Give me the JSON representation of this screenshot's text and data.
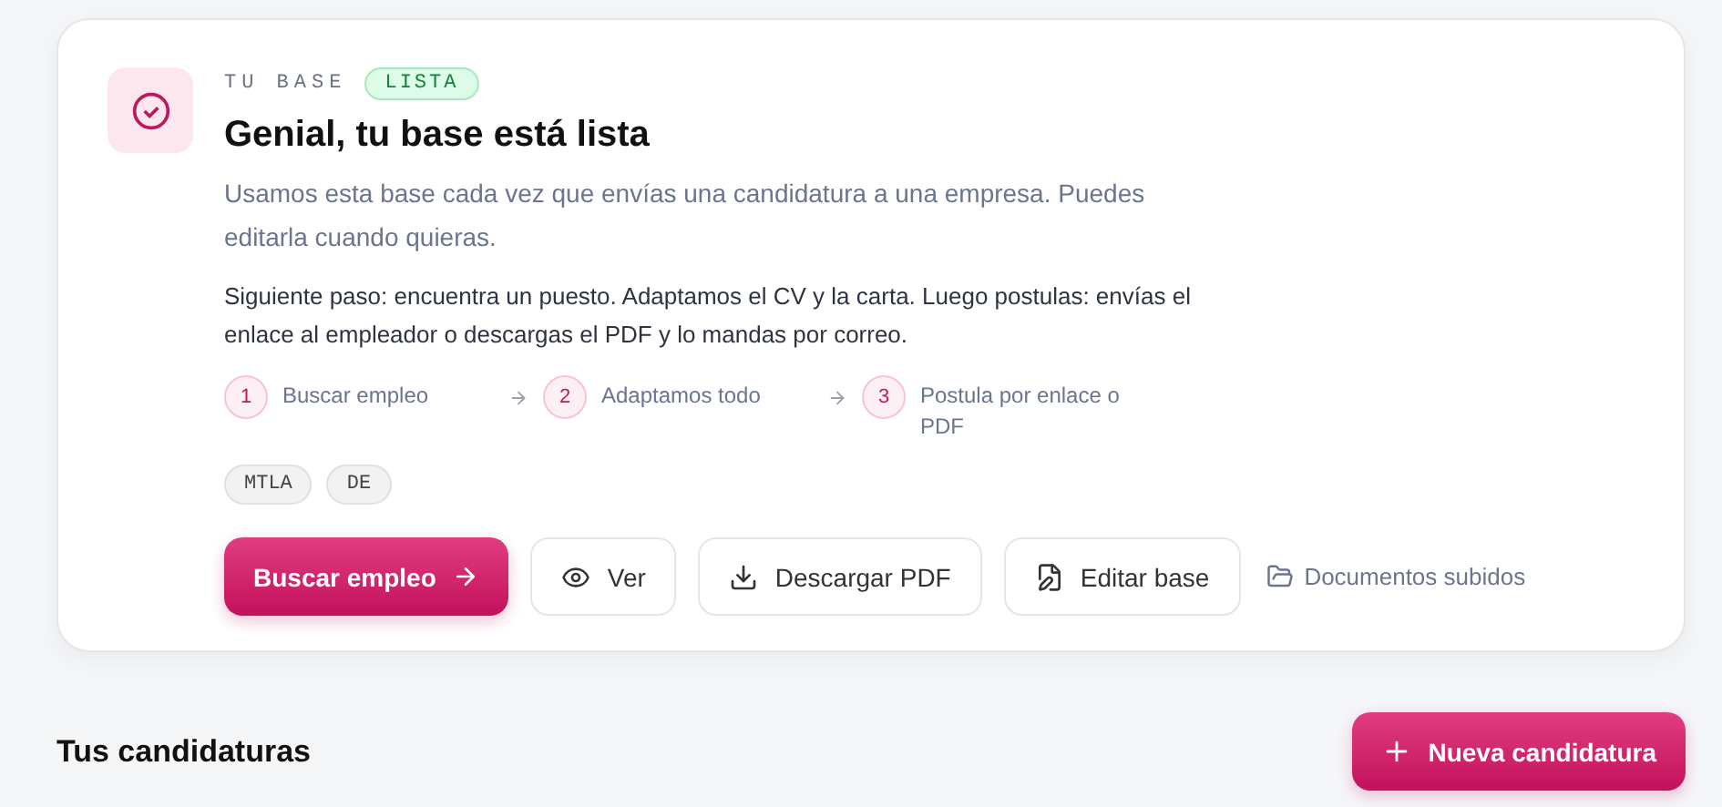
{
  "card": {
    "eyebrow": "TU BASE",
    "status_badge": "LISTA",
    "title": "Genial, tu base está lista",
    "description": "Usamos esta base cada vez que envías una candidatura a una empresa. Puedes editarla cuando quieras.",
    "next_step": "Siguiente paso: encuentra un puesto. Adaptamos el CV y la carta. Luego postulas: envías el enlace al empleador o descargas el PDF y lo mandas por correo.",
    "steps": [
      {
        "number": "1",
        "label": "Buscar empleo"
      },
      {
        "number": "2",
        "label": "Adaptamos todo"
      },
      {
        "number": "3",
        "label": "Postula por enlace o PDF"
      }
    ],
    "tags": [
      "MTLA",
      "DE"
    ],
    "actions": [
      {
        "kind": "primary",
        "label": "Buscar empleo"
      },
      {
        "kind": "view",
        "label": "Ver"
      },
      {
        "kind": "download",
        "label": "Descargar PDF"
      },
      {
        "kind": "edit",
        "label": "Editar base"
      },
      {
        "kind": "folder",
        "label": "Documentos subidos"
      }
    ]
  },
  "applications": {
    "title": "Tus candidaturas",
    "new_button": "Nueva candidatura"
  }
}
